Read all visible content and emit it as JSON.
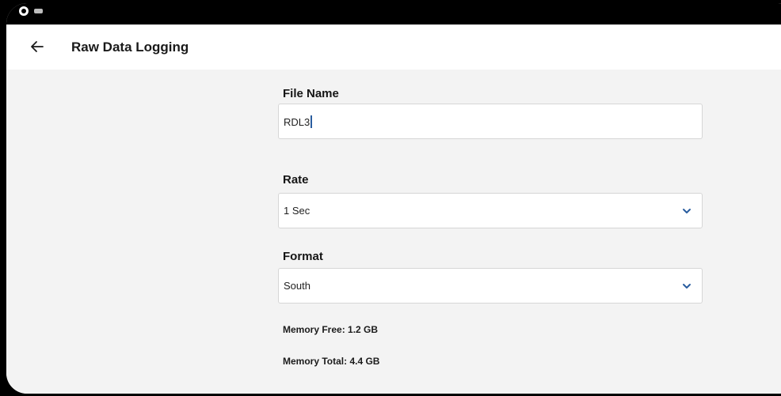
{
  "app_title": "Raw Data Logging",
  "icons": {
    "back": "arrow-left-icon",
    "dropdown": "chevron-down-icon",
    "status_camera": "camera-icon",
    "status_keyboard": "keyboard-icon"
  },
  "colors": {
    "accent": "#2a5d9f",
    "background": "#f3f3f3",
    "field_background": "#ffffff"
  },
  "form": {
    "file_name": {
      "label": "File Name",
      "value": "RDL3"
    },
    "rate": {
      "label": "Rate",
      "selected": "1 Sec"
    },
    "format": {
      "label": "Format",
      "selected": "South"
    }
  },
  "memory": {
    "free": "Memory Free:  1.2 GB",
    "total": "Memory Total:  4.4 GB"
  }
}
